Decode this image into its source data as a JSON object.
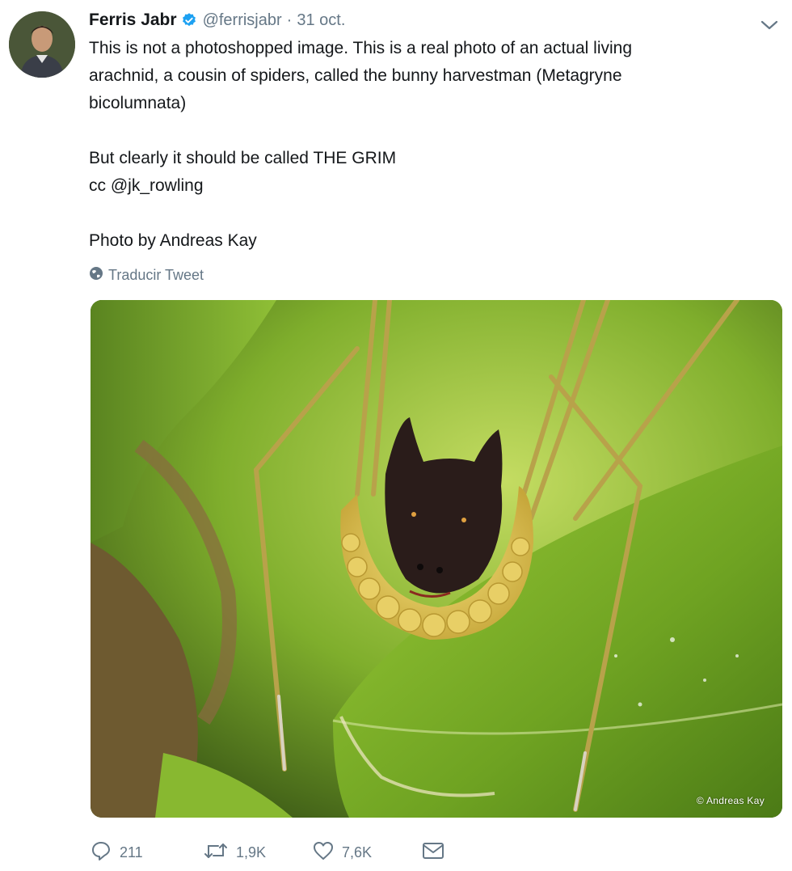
{
  "tweet": {
    "author_name": "Ferris Jabr",
    "handle": "@ferrisjabr",
    "separator": "·",
    "date": "31 oct.",
    "text_lines": [
      "This is not a photoshopped image. This is a real photo of an actual living",
      "arachnid, a cousin of spiders, called the bunny harvestman (Metagryne",
      "bicolumnata)",
      "But clearly it should be called THE GRIM",
      "cc @jk_rowling",
      "Photo by Andreas Kay"
    ],
    "translate_label": "Traducir Tweet",
    "photo_credit": "© Andreas Kay",
    "photo_subject": "bunny harvestman on green leaf"
  },
  "actions": {
    "reply_count": "211",
    "retweet_count": "1,9K",
    "like_count": "7,6K"
  },
  "icons": {
    "verified": "verified-badge-icon",
    "menu": "chevron-down-icon",
    "translate": "globe-icon",
    "reply": "reply-icon",
    "retweet": "retweet-icon",
    "like": "heart-icon",
    "message": "envelope-icon"
  },
  "colors": {
    "verified_blue": "#1da1f2",
    "muted_gray": "#657786",
    "text": "#14171a"
  }
}
